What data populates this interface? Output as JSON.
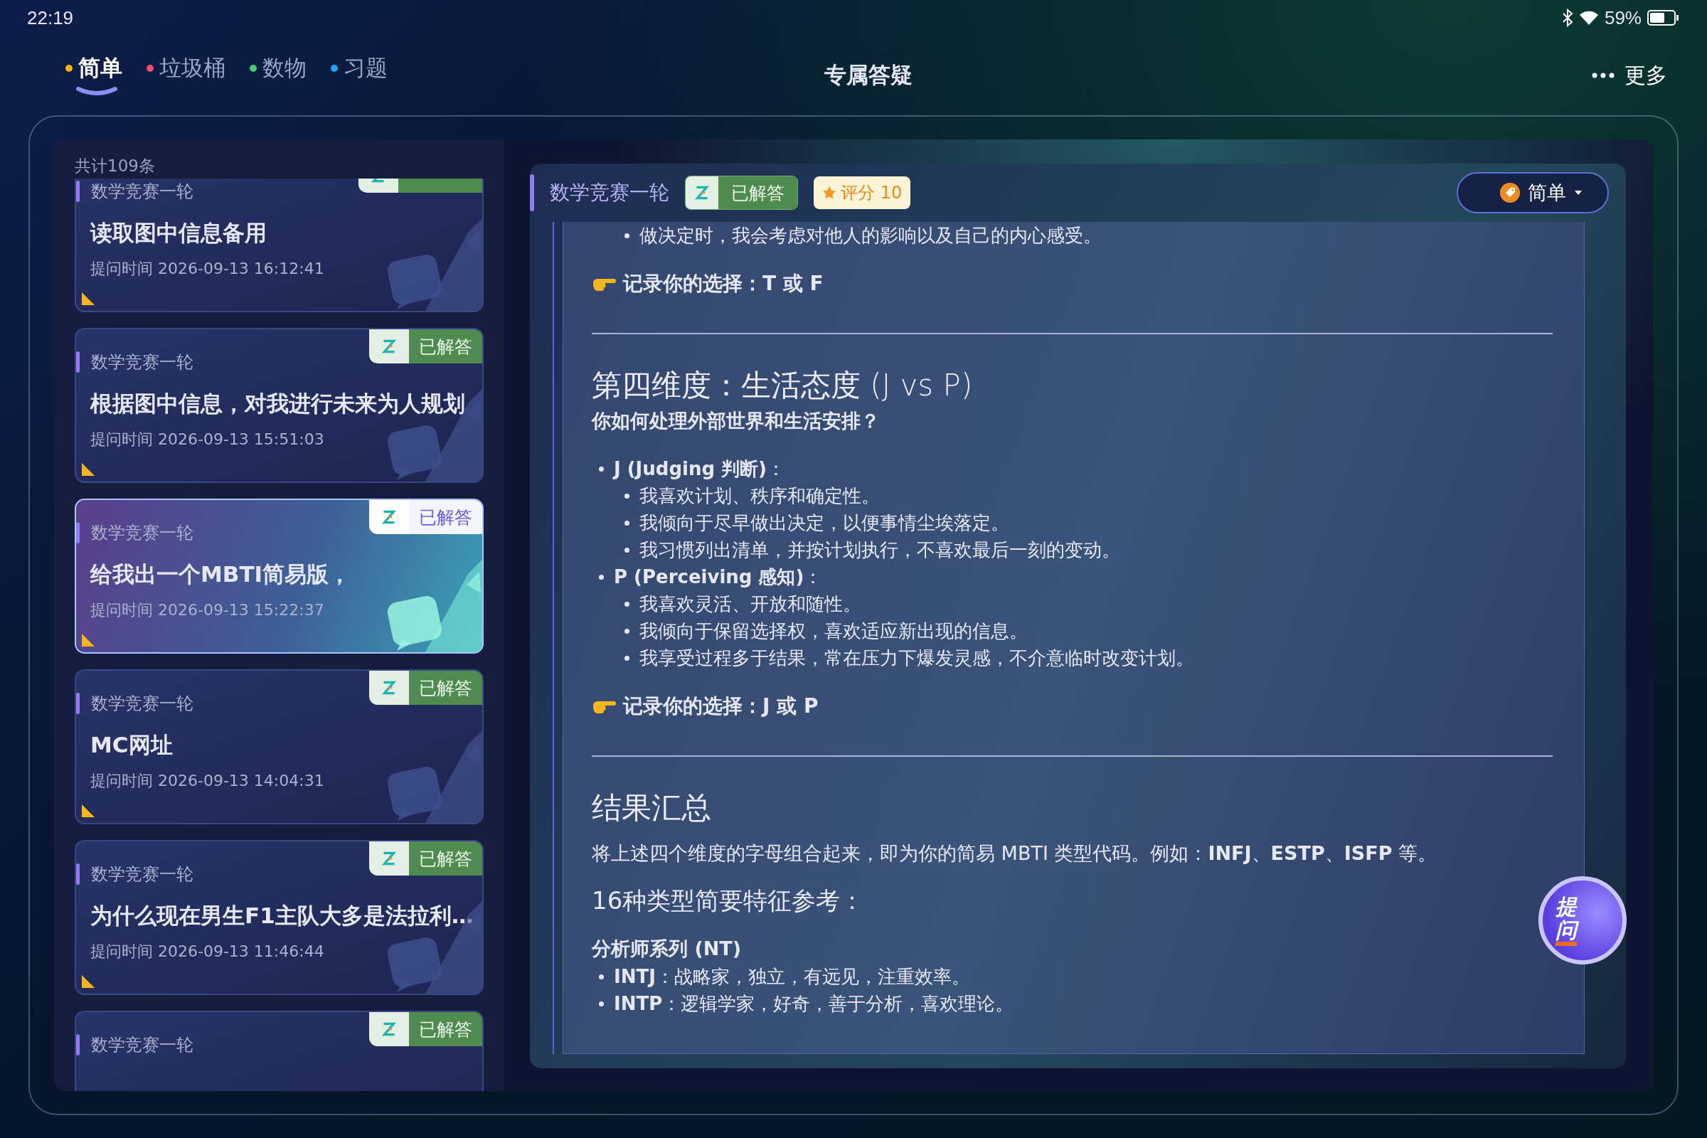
{
  "status_bar": {
    "time": "22:19",
    "battery": "59%"
  },
  "nav": {
    "tabs": [
      {
        "label": "简单",
        "selected": true,
        "color": "#f5b70f"
      },
      {
        "label": "垃圾桶",
        "selected": false,
        "color": "#f0506e"
      },
      {
        "label": "数物",
        "selected": false,
        "color": "#3ecf6e"
      },
      {
        "label": "习题",
        "selected": false,
        "color": "#1ea7f0"
      }
    ],
    "title": "专属答疑",
    "more": "更多"
  },
  "list": {
    "count": "共计109条",
    "items": [
      {
        "category": "数学竞赛一轮",
        "title": "读取图中信息备用",
        "time": "提问时间 2026-09-13 16:12:41",
        "selected": false
      },
      {
        "category": "数学竞赛一轮",
        "status": "已解答",
        "title": "根据图中信息，对我进行未来为人规划",
        "time": "提问时间 2026-09-13 15:51:03",
        "selected": false
      },
      {
        "category": "数学竞赛一轮",
        "status": "已解答",
        "title": "给我出一个MBTI简易版，",
        "time": "提问时间 2026-09-13 15:22:37",
        "selected": true
      },
      {
        "category": "数学竞赛一轮",
        "status": "已解答",
        "title": "MC网址",
        "time": "提问时间 2026-09-13 14:04:31",
        "selected": false
      },
      {
        "category": "数学竞赛一轮",
        "status": "已解答",
        "title": "为什么现在男生F1主队大多是法拉利…",
        "time": "提问时间 2026-09-13 11:46:44",
        "selected": false
      },
      {
        "category": "数学竞赛一轮",
        "status": "已解答",
        "selected": false
      }
    ]
  },
  "detail": {
    "category": "数学竞赛一轮",
    "status": "已解答",
    "score": "评分 10",
    "difficulty": "简单",
    "blocks": [
      {
        "kind": "list",
        "items": [
          {
            "children": [
              {
                "text": "做决定时，我会考虑对他人的影响以及自己的内心感受。"
              }
            ]
          }
        ]
      },
      {
        "kind": "choice",
        "text": "记录你的选择：T 或 F"
      },
      {
        "kind": "rule"
      },
      {
        "kind": "heading",
        "text": "第四维度：生活态度 (J vs P)"
      },
      {
        "kind": "question",
        "text": "你如何处理外部世界和生活安排？"
      },
      {
        "kind": "list",
        "items": [
          {
            "text": "**J (Judging 判断)**：",
            "children": [
              {
                "text": "我喜欢计划、秩序和确定性。"
              },
              {
                "text": "我倾向于尽早做出决定，以便事情尘埃落定。"
              },
              {
                "text": "我习惯列出清单，并按计划执行，不喜欢最后一刻的变动。"
              }
            ]
          },
          {
            "text": "**P (Perceiving 感知)**：",
            "children": [
              {
                "text": "我喜欢灵活、开放和随性。"
              },
              {
                "text": "我倾向于保留选择权，喜欢适应新出现的信息。"
              },
              {
                "text": "我享受过程多于结果，常在压力下爆发灵感，不介意临时改变计划。"
              }
            ]
          }
        ]
      },
      {
        "kind": "choice",
        "text": "记录你的选择：J 或 P"
      },
      {
        "kind": "rule"
      },
      {
        "kind": "heading",
        "text": "结果汇总"
      },
      {
        "kind": "paragraph",
        "text": "将上述四个维度的字母组合起来，即为你的简易 MBTI 类型代码。例如：**INFJ**、**ESTP**、**ISFP** 等。"
      },
      {
        "kind": "subheading",
        "text": "16种类型简要特征参考："
      },
      {
        "kind": "group",
        "text": "分析师系列 (NT)"
      },
      {
        "kind": "list",
        "items": [
          {
            "text": "**INTJ**：战略家，独立，有远见，注重效率。"
          },
          {
            "text": "**INTP**：逻辑学家，好奇，善于分析，喜欢理论。"
          }
        ]
      }
    ]
  },
  "ask_button": {
    "label": "提问"
  }
}
